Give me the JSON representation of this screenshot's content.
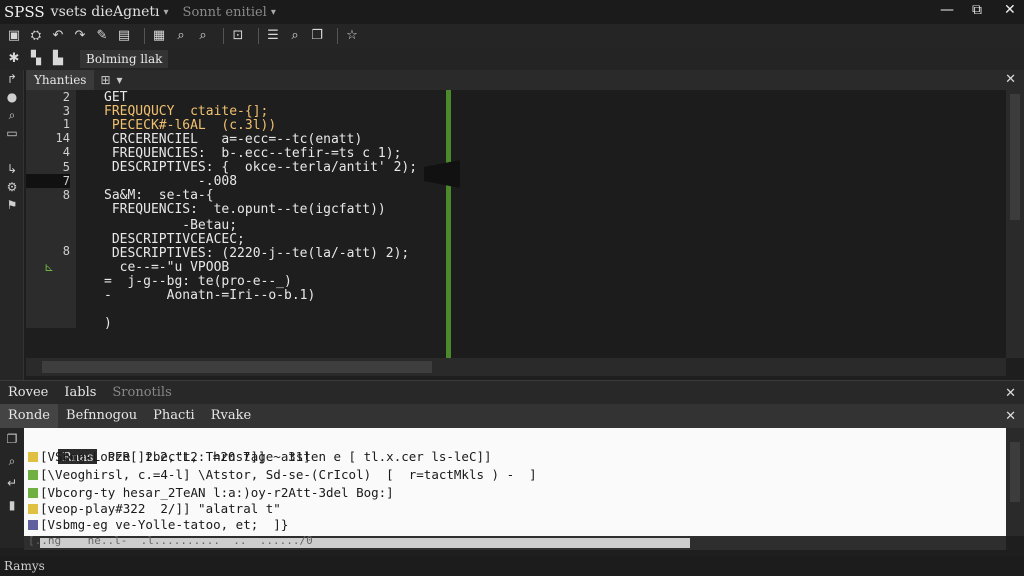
{
  "window": {
    "app_name": "SPSS",
    "project": "vsets dieAgnetı",
    "mode": "Sonnt enitiel",
    "min": "—",
    "max": "⧉",
    "close": "✕"
  },
  "toolbar2": {
    "label": "Bolming llak"
  },
  "editor": {
    "tab_label": "Yhanties",
    "line_numbers": [
      "2",
      "3",
      "1",
      "14",
      "4",
      "5",
      "7",
      "8",
      "",
      "",
      "",
      "8"
    ],
    "code_lines": [
      "GET",
      "FREQUQUCY  ctaite-{];",
      " PECECK#-l6AL  (c.3l))",
      " CRCERENCIEL   a=-ecc=--tc(enatt)",
      " FREQUENCIES:  b-.ecc--tefir-=ts c 1);",
      " DESCRIPTIVES: {  okce--terla/antit' 2);",
      "            -.008",
      "Sa&M:  se-ta-{",
      " FREQUENCIS:  te.opunt--te(igcfatt))",
      "          -Betau;",
      " DESCRIPTIVCEACEC;",
      " DESCRIPTIVES: (2220-j--te(la/-att) 2);",
      "  ce--=-\"u VPOOB",
      "=  j-g--bg: te(pro-e--_)",
      "-       Aonatn-=Iri--o-b.1)",
      "",
      ")"
    ]
  },
  "panel": {
    "tabs": [
      "Rovee",
      "Iabls",
      "Sronotils"
    ],
    "subtabs": [
      "Ronde",
      "Befnnogou",
      "Phacti",
      "Rvake"
    ],
    "output_header": "Rnas",
    "output_header_text": "PER[]t.2,tL2: =20 7]]   31]",
    "output_rows": [
      {
        "color": "#e0c040",
        "text": "[VSbmg-Losze  2bec\"t, Thrnstage~atsten e [ tl.x.cer ls-leC]]"
      },
      {
        "color": "#70b040",
        "text": "[\\Veoghirsl, c.=4-l] \\Atstor, Sd-se-(CrIcol)  [  r=tactMkls ) -  ]"
      },
      {
        "color": "#70b040",
        "text": "[Vbcorg-ty hesar_2TeAN l:a:)oy-r2Att-3del Bog:]"
      },
      {
        "color": "#e0c040",
        "text": "[veop-play#322  2/]] \"alatral t\""
      },
      {
        "color": "#6060a0",
        "text": "[Vsbmg-eg ve-Yolle-tatoo, et;  ]}"
      },
      {
        "color": "#9090c0",
        "text": "[..ng    ne..l-  .l..........  ..  ....../0"
      }
    ]
  },
  "status": {
    "text": "Ramys"
  }
}
